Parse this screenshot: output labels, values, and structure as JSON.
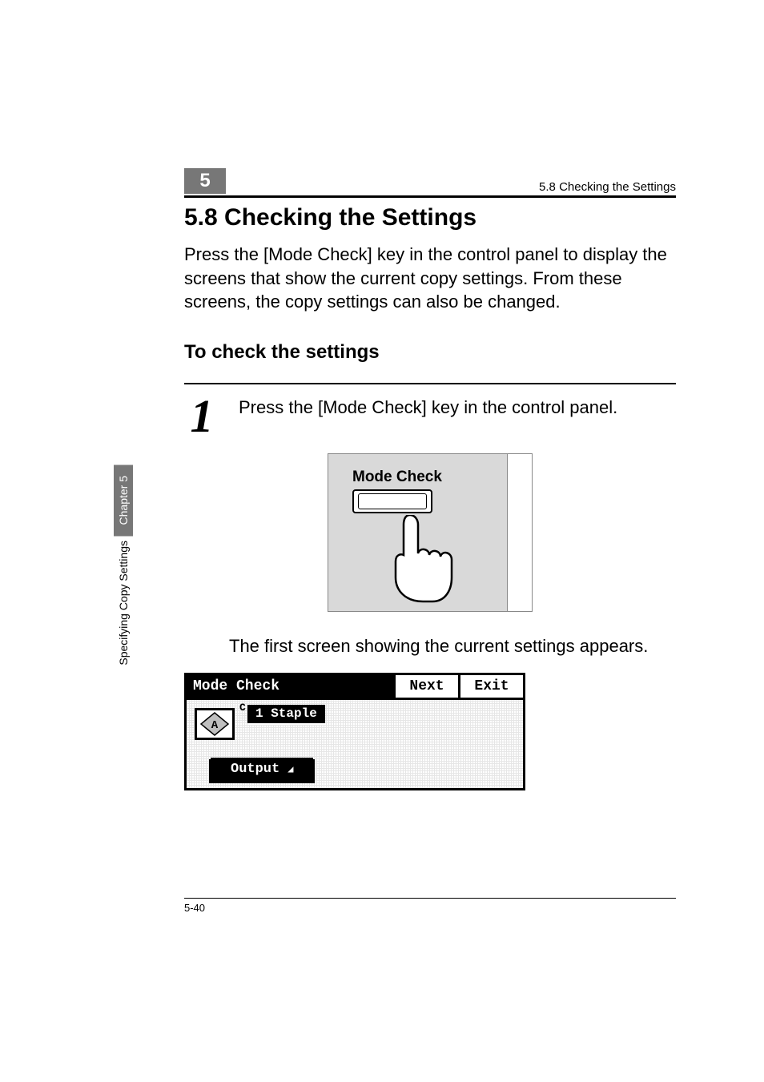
{
  "header": {
    "chapter_number": "5",
    "running_title": "5.8 Checking the Settings"
  },
  "section": {
    "title": "5.8  Checking the Settings",
    "intro": "Press the [Mode Check] key in the control panel to display the screens that show the current copy settings. From these screens, the copy settings can also be changed."
  },
  "subsection": {
    "title": "To check the settings"
  },
  "step1": {
    "number": "1",
    "text": "Press the [Mode Check] key in the control panel.",
    "diagram_label": "Mode Check",
    "result_text": "The first screen showing the current settings appears."
  },
  "lcd": {
    "title": "Mode Check",
    "next": "Next",
    "exit": "Exit",
    "staple": "1 Staple",
    "icon_letter": "A",
    "output": "Output"
  },
  "side": {
    "chapter": "Chapter 5",
    "section": "Specifying Copy Settings"
  },
  "footer": {
    "page": "5-40"
  }
}
